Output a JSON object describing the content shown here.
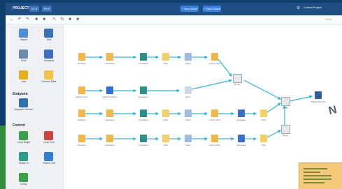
{
  "app": {
    "title": "PROJECT",
    "badge_a": "v1.0",
    "badge_b": "Run",
    "top_btn_1": "+ New Node",
    "top_btn_2": "+ Save Model",
    "right_label": "Current Project"
  },
  "toolbar": {
    "icons": [
      "back-icon",
      "undo-icon",
      "redo-icon",
      "zoom-in-icon",
      "zoom-out-icon",
      "cursor-icon",
      "refresh-icon",
      "run-icon",
      "stop-icon"
    ],
    "right_text": "100%"
  },
  "palette": {
    "items": [
      {
        "label": "Import",
        "color": "#4d8ed8"
      },
      {
        "label": "Sort",
        "color": "#3b6fb6"
      },
      {
        "label": "Rule",
        "color": "#6d87aa"
      },
      {
        "label": "Compute",
        "color": "#3f6ec0"
      },
      {
        "label": "Join",
        "color": "#e5b020"
      },
      {
        "label": "Column Filter",
        "color": "#f2c14a"
      }
    ],
    "section_1": "Endpoint",
    "endpoint_item": {
      "label": "Dispatch Service",
      "color": "#2f6fb3"
    },
    "section_2": "Control",
    "control_items": [
      {
        "label": "Loop Begin",
        "color": "#3aa04a"
      },
      {
        "label": "Loop End",
        "color": "#c9453d"
      },
      {
        "label": "Switch In",
        "color": "#2d9a8a"
      },
      {
        "label": "Switch Out",
        "color": "#2f7fd0"
      },
      {
        "label": "Delay",
        "color": "#3aa04a"
      }
    ]
  },
  "nodes": {
    "label_short": "Operation",
    "row1": [
      "Operation",
      "Calculation",
      "Correlation",
      "Filter",
      "Select",
      "Column Filter"
    ],
    "row2": [
      "Model Import",
      "Model Prediction",
      "Evaluation",
      "Score"
    ],
    "row3": [
      "Operation",
      "Calculation",
      "Correlation",
      "Filter",
      "Select",
      "Column Filter",
      "Aggregate",
      "Filter"
    ],
    "row4": [
      "Operation",
      "Calculation",
      "Correlation",
      "Filter",
      "Select",
      "Column Filter",
      "Aggregate",
      "Filter"
    ],
    "merge_1": "Merge",
    "merge_2": "Merge",
    "merge_3": "Merge",
    "output": "Dispatch Results"
  },
  "colors": {
    "accent": "#2fb3de",
    "titlebar": "#1f4e82",
    "file_node": "#f2b749",
    "monitor_node": "#2d8f8a",
    "minimap": "#f5c97a"
  }
}
